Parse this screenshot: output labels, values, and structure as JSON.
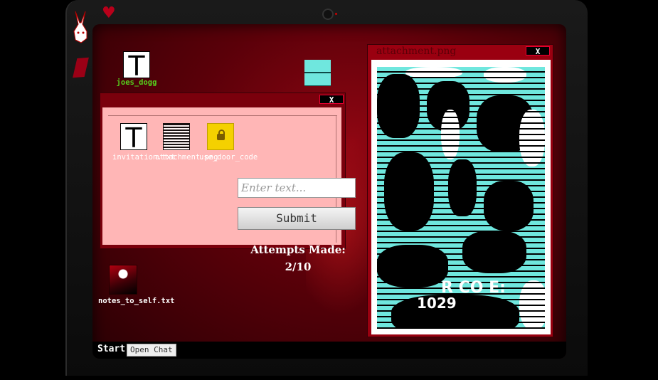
{
  "desktop": {
    "icons": [
      {
        "label": "joes_dogg",
        "glyph": "T"
      },
      {
        "label": "notes_to_self.txt"
      }
    ]
  },
  "file_window": {
    "close_label": "X",
    "files": [
      {
        "label": "invitation.txt",
        "glyph": "T"
      },
      {
        "label": "attachment.png"
      },
      {
        "label": "use_door_code"
      }
    ]
  },
  "login": {
    "placeholder": "Enter text...",
    "submit_label": "Submit",
    "attempts_label": "Attempts Made:",
    "attempts_value": "2/10"
  },
  "attachment_window": {
    "title": "attachment.png",
    "close_label": "X",
    "image_text_1": "R CO E:",
    "image_text_2": "1029"
  },
  "taskbar": {
    "start_label": "Start",
    "chat_label": "Open Chat"
  },
  "colors": {
    "accent": "#8e0612",
    "teal": "#6fe7de",
    "icon_label_green": "#56d11d",
    "pink_panel": "#ffb6b6"
  }
}
